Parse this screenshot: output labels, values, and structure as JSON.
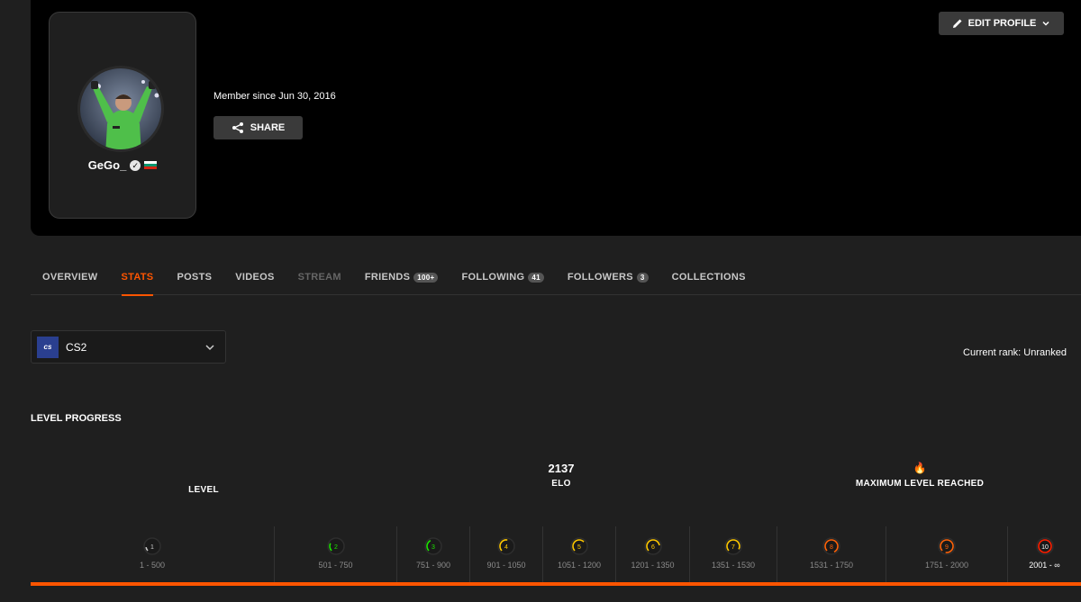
{
  "profile": {
    "username": "GeGo_",
    "member_since": "Member since Jun 30, 2016",
    "share_label": "SHARE",
    "edit_label": "EDIT PROFILE",
    "flag_colors": [
      "#ffffff",
      "#00966e",
      "#d62612"
    ]
  },
  "tabs": [
    {
      "label": "OVERVIEW",
      "state": "normal"
    },
    {
      "label": "STATS",
      "state": "active"
    },
    {
      "label": "POSTS",
      "state": "normal"
    },
    {
      "label": "VIDEOS",
      "state": "normal"
    },
    {
      "label": "STREAM",
      "state": "disabled"
    },
    {
      "label": "FRIENDS",
      "badge": "100+",
      "state": "normal"
    },
    {
      "label": "FOLLOWING",
      "badge": "41",
      "state": "normal"
    },
    {
      "label": "FOLLOWERS",
      "badge": "3",
      "state": "normal"
    },
    {
      "label": "COLLECTIONS",
      "state": "normal"
    }
  ],
  "game": {
    "logo_text": "cs",
    "name": "CS2"
  },
  "current_rank": "Current rank: Unranked",
  "level_progress": {
    "title": "LEVEL PROGRESS",
    "level_label": "LEVEL",
    "elo_value": "2137",
    "elo_label": "ELO",
    "fire_icon": "🔥",
    "max_label": "MAXIMUM LEVEL REACHED",
    "progress": 1.0,
    "levels": [
      {
        "level": "1",
        "range": "1 - 500",
        "color": "#cccccc"
      },
      {
        "level": "2",
        "range": "501 - 750",
        "color": "#1ce400"
      },
      {
        "level": "3",
        "range": "751 - 900",
        "color": "#1ce400"
      },
      {
        "level": "4",
        "range": "901 - 1050",
        "color": "#ffc800"
      },
      {
        "level": "5",
        "range": "1051 - 1200",
        "color": "#ffc800"
      },
      {
        "level": "6",
        "range": "1201 - 1350",
        "color": "#ffc800"
      },
      {
        "level": "7",
        "range": "1351 - 1530",
        "color": "#ffc800"
      },
      {
        "level": "8",
        "range": "1531 - 1750",
        "color": "#ff6309"
      },
      {
        "level": "9",
        "range": "1751 - 2000",
        "color": "#ff6309"
      },
      {
        "level": "10",
        "range": "2001 - ∞",
        "color": "#fe1f00",
        "current": true
      }
    ]
  },
  "colors": {
    "accent": "#ff5500",
    "background": "#1f1f1f",
    "banner": "#000000"
  }
}
